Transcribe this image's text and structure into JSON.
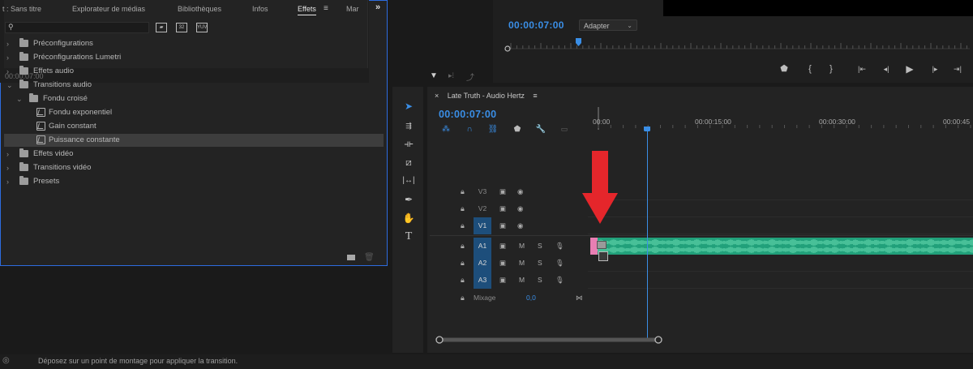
{
  "source_monitor": {
    "timecode": "00:00:07:00"
  },
  "program_monitor": {
    "timecode": "00:00:07:00",
    "fit_dropdown": "Adapter"
  },
  "effects_panel": {
    "tabs": [
      {
        "label": "t : Sans titre"
      },
      {
        "label": "Explorateur de médias"
      },
      {
        "label": "Bibliothèques"
      },
      {
        "label": "Infos"
      },
      {
        "label": "Effets",
        "active": true
      },
      {
        "label": "Mar"
      }
    ],
    "tree": [
      {
        "label": "Préconfigurations",
        "kind": "folder",
        "expanded": false,
        "level": 0
      },
      {
        "label": "Préconfigurations Lumetri",
        "kind": "folder",
        "expanded": false,
        "level": 0
      },
      {
        "label": "Effets audio",
        "kind": "folder",
        "expanded": false,
        "level": 0
      },
      {
        "label": "Transitions audio",
        "kind": "folder",
        "expanded": true,
        "level": 0
      },
      {
        "label": "Fondu croisé",
        "kind": "folder",
        "expanded": true,
        "level": 1
      },
      {
        "label": "Fondu exponentiel",
        "kind": "effect",
        "level": 2
      },
      {
        "label": "Gain constant",
        "kind": "effect",
        "level": 2
      },
      {
        "label": "Puissance constante",
        "kind": "effect",
        "level": 2,
        "selected": true
      },
      {
        "label": "Effets vidéo",
        "kind": "folder",
        "expanded": false,
        "level": 0
      },
      {
        "label": "Transitions vidéo",
        "kind": "folder",
        "expanded": false,
        "level": 0
      },
      {
        "label": "Presets",
        "kind": "folder",
        "expanded": false,
        "level": 0
      }
    ]
  },
  "timeline": {
    "sequence_tab": "Late Truth - Audio Hertz",
    "timecode": "00:00:07:00",
    "ruler_labels": [
      "00:00",
      "00:00:15:00",
      "00:00:30:00",
      "00:00:45"
    ],
    "video_tracks": [
      "V3",
      "V2",
      "V1"
    ],
    "audio_tracks": [
      "A1",
      "A2",
      "A3"
    ],
    "mute_label": "M",
    "solo_label": "S",
    "mix_label": "Mixage",
    "mix_value": "0,0"
  },
  "status_bar": {
    "text": "Déposez sur un point de montage pour appliquer la transition."
  },
  "colors": {
    "accent": "#3a8ee6",
    "clip": "#21a07a",
    "arrow": "#e5262b",
    "panel_focus": "#2d6cdf"
  }
}
